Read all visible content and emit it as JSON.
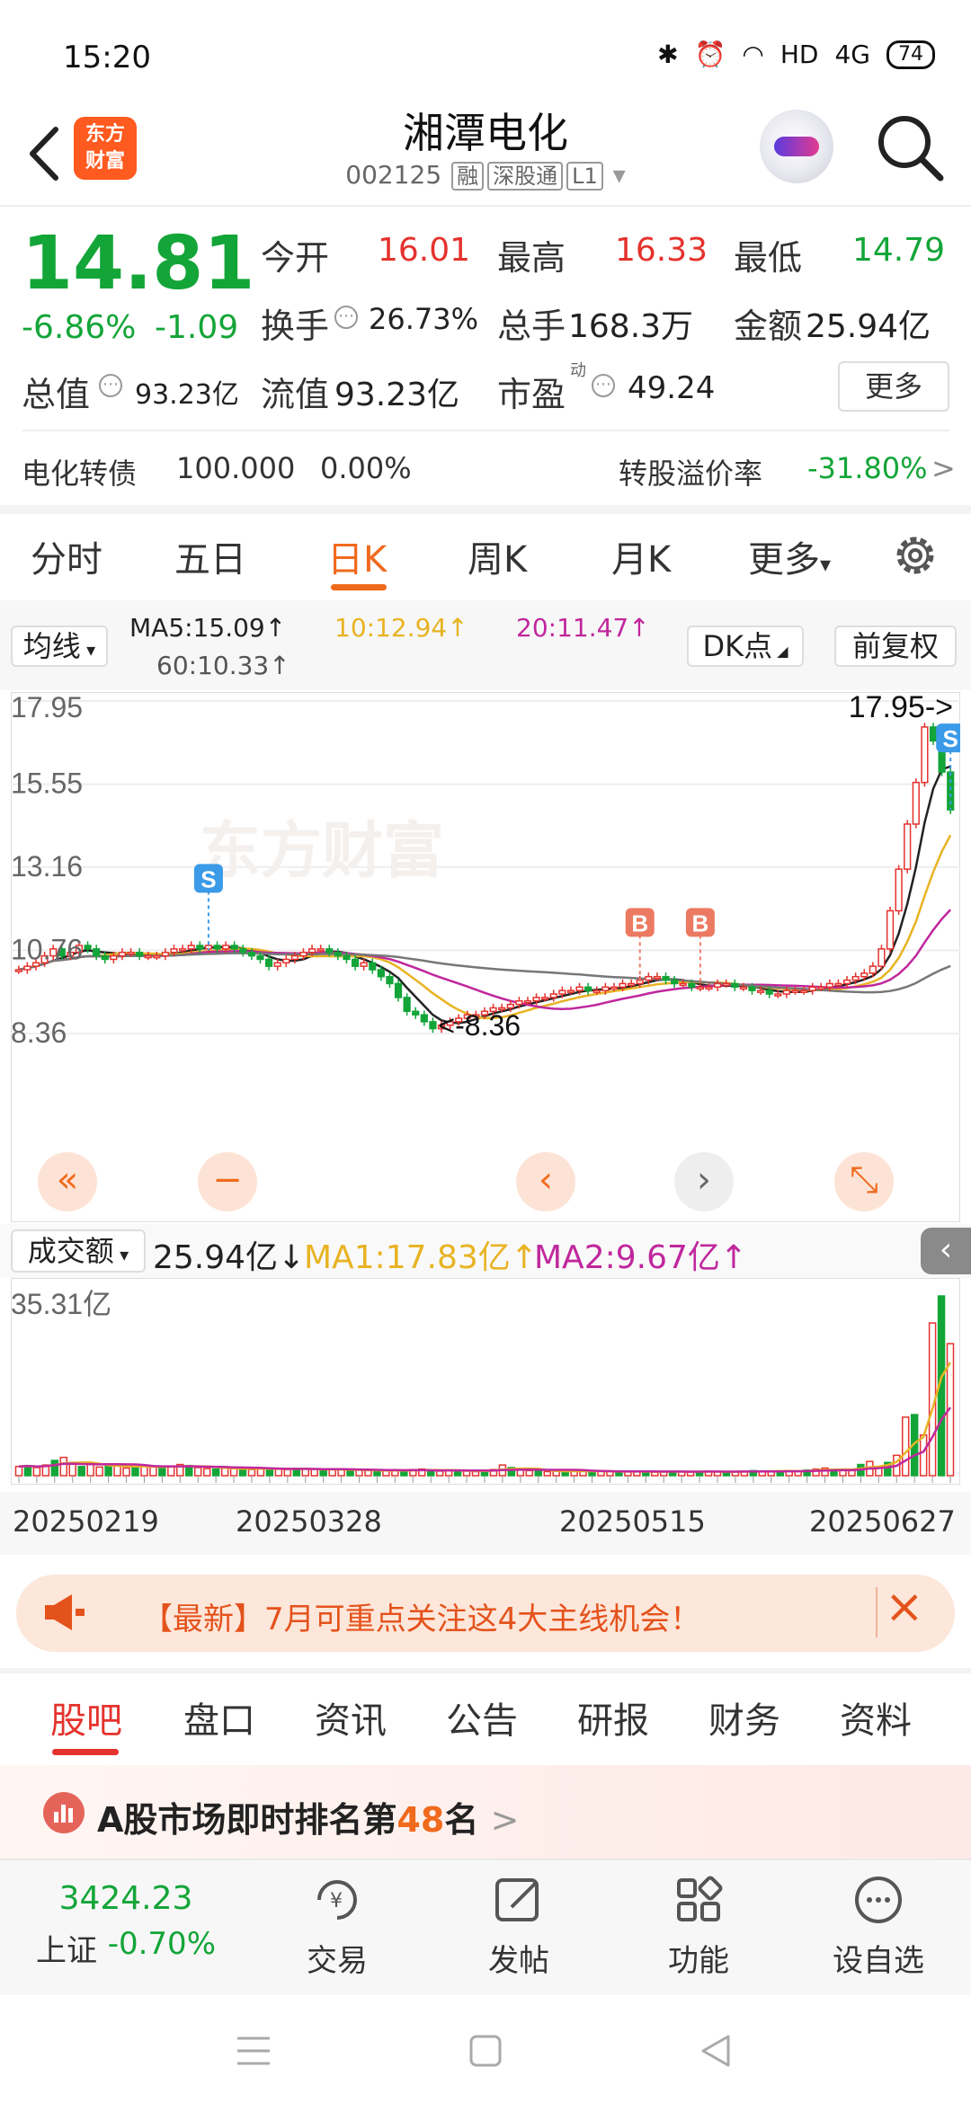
{
  "status_bar": {
    "time": "15:20",
    "network": "HD",
    "signal": "4G",
    "battery": "74"
  },
  "header": {
    "app_logo": "东方\n财富",
    "stock_name": "湘潭电化",
    "stock_code": "002125",
    "tag_margin": "融",
    "tag_connect": "深股通",
    "tag_level": "L1"
  },
  "quote": {
    "price": "14.81",
    "change_pct": "-6.86%",
    "change_abs": "-1.09",
    "open_label": "今开",
    "open_value": "16.01",
    "high_label": "最高",
    "high_value": "16.33",
    "low_label": "最低",
    "low_value": "14.79",
    "turnover_label": "换手",
    "turnover_value": "26.73%",
    "volume_label": "总手",
    "volume_value": "168.3万",
    "amount_label": "金额",
    "amount_value": "25.94亿",
    "total_cap_label": "总值",
    "total_cap_value": "93.23亿",
    "float_cap_label": "流值",
    "float_cap_value": "93.23亿",
    "pe_label": "市盈",
    "pe_sup": "动",
    "pe_value": "49.24",
    "more_label": "更多"
  },
  "convertible": {
    "name": "电化转债",
    "price": "100.000",
    "change": "0.00%",
    "premium_label": "转股溢价率",
    "premium_value": "-31.80%",
    "arrow": ">"
  },
  "period_tabs": [
    "分时",
    "五日",
    "日K",
    "周K",
    "月K",
    "更多"
  ],
  "active_period": "日K",
  "ma": {
    "selector": "均线",
    "ma5": "MA5:15.09↑",
    "ma10": "10:12.94↑",
    "ma20": "20:11.47↑",
    "ma60": "60:10.33↑",
    "dk_label": "DK点",
    "adjust_label": "前复权"
  },
  "colors": {
    "up": "#e5322d",
    "down": "#13a538",
    "accent": "#f06a1d",
    "ma5": "#222222",
    "ma10": "#e8b323",
    "ma20": "#c0279d",
    "ma60": "#777777"
  },
  "chart_data": {
    "type": "candlestick",
    "ylim": [
      8.36,
      17.95
    ],
    "y_ticks": [
      "17.95",
      "15.55",
      "13.16",
      "10.76",
      "8.36"
    ],
    "max_marker": "17.95->",
    "min_marker": "<-8.36",
    "signals": [
      "S",
      "B",
      "B",
      "S"
    ],
    "x_ticks": [
      "20250219",
      "20250328",
      "20250515",
      "20250627"
    ],
    "watermark": "东方财富",
    "closes": [
      10.2,
      10.3,
      10.4,
      10.6,
      10.8,
      10.6,
      10.7,
      10.9,
      10.8,
      10.6,
      10.5,
      10.6,
      10.7,
      10.7,
      10.6,
      10.6,
      10.6,
      10.7,
      10.8,
      10.8,
      10.9,
      10.8,
      10.9,
      10.8,
      10.9,
      10.8,
      10.7,
      10.6,
      10.5,
      10.3,
      10.4,
      10.5,
      10.6,
      10.7,
      10.8,
      10.8,
      10.7,
      10.6,
      10.5,
      10.3,
      10.4,
      10.2,
      10.0,
      9.8,
      9.4,
      9.0,
      8.9,
      8.7,
      8.5,
      8.6,
      8.7,
      8.8,
      8.9,
      8.9,
      9.0,
      9.1,
      9.1,
      9.2,
      9.3,
      9.3,
      9.4,
      9.4,
      9.5,
      9.6,
      9.6,
      9.7,
      9.6,
      9.6,
      9.7,
      9.7,
      9.8,
      9.8,
      9.9,
      10.0,
      10.0,
      9.9,
      9.8,
      9.8,
      9.7,
      9.7,
      9.7,
      9.8,
      9.8,
      9.7,
      9.7,
      9.6,
      9.6,
      9.5,
      9.5,
      9.6,
      9.6,
      9.6,
      9.7,
      9.7,
      9.8,
      9.8,
      9.9,
      10.0,
      10.1,
      10.3,
      10.8,
      11.9,
      13.1,
      14.4,
      15.6,
      17.2,
      16.8,
      15.9,
      14.81
    ],
    "volume": {
      "label": "成交额",
      "value": "25.94亿↓",
      "ma1": "MA1:17.83亿↑",
      "ma2": "MA2:9.67亿↑",
      "max_tick": "35.31亿",
      "bars": [
        1.8,
        2.0,
        1.6,
        2.1,
        3.0,
        3.6,
        2.4,
        1.8,
        2.2,
        1.7,
        2.1,
        1.9,
        1.5,
        1.8,
        2.0,
        1.7,
        1.6,
        1.8,
        2.2,
        2.0,
        1.6,
        1.4,
        1.3,
        1.5,
        1.4,
        1.3,
        1.2,
        1.4,
        1.5,
        1.3,
        1.2,
        1.4,
        1.3,
        1.2,
        1.1,
        1.2,
        1.3,
        1.0,
        1.1,
        1.0,
        0.9,
        1.0,
        1.1,
        1.0,
        1.2,
        1.3,
        1.0,
        0.9,
        1.0,
        1.1,
        0.9,
        0.8,
        0.9,
        1.2,
        2.1,
        1.6,
        1.2,
        1.0,
        0.9,
        0.8,
        0.9,
        0.8,
        1.0,
        0.9,
        0.8,
        0.9,
        0.8,
        0.7,
        0.8,
        0.9,
        0.8,
        0.7,
        0.8,
        0.9,
        0.8,
        0.7,
        0.8,
        0.9,
        0.8,
        0.7,
        0.8,
        0.9,
        1.0,
        0.9,
        0.8,
        0.9,
        1.0,
        0.9,
        1.1,
        1.3,
        1.5,
        1.2,
        1.1,
        1.0,
        2.2,
        2.8,
        1.8,
        2.6,
        4.0,
        11.5,
        12.0,
        8.0,
        30.0,
        35.31,
        25.94
      ]
    }
  },
  "banner": {
    "text": "【最新】7月可重点关注这4大主线机会！"
  },
  "bottom_tabs": [
    "股吧",
    "盘口",
    "资讯",
    "公告",
    "研报",
    "财务",
    "资料"
  ],
  "active_bottom_tab": "股吧",
  "rank": {
    "prefix": "A股市场即时排名第",
    "number": "48",
    "suffix": "名",
    "arrow": ">"
  },
  "toolbar": {
    "index_value": "3424.23",
    "index_name": "上证",
    "index_change": "-0.70%",
    "trade": "交易",
    "post": "发帖",
    "functions": "功能",
    "watchlist": "设自选"
  }
}
